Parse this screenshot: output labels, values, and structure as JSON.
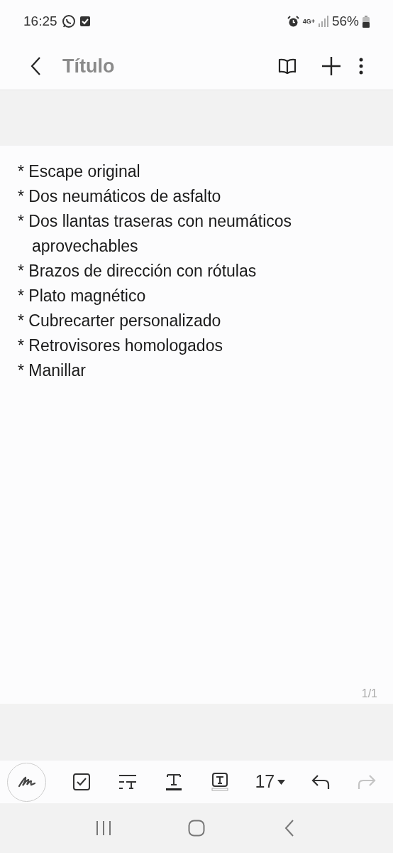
{
  "status_bar": {
    "time": "16:25",
    "network": "4G+",
    "battery": "56%"
  },
  "header": {
    "title": "Título"
  },
  "note": {
    "lines": [
      "* Escape original",
      "* Dos neumáticos de asfalto",
      "* Dos llantas traseras con neumáticos aprovechables",
      "* Brazos de dirección con rótulas",
      "* Plato magnético",
      "* Cubrecarter personalizado",
      "* Retrovisores homologados",
      "* Manillar"
    ],
    "page_indicator": "1/1"
  },
  "toolbar": {
    "font_size": "17",
    "undo_disabled": false,
    "redo_disabled": true
  }
}
